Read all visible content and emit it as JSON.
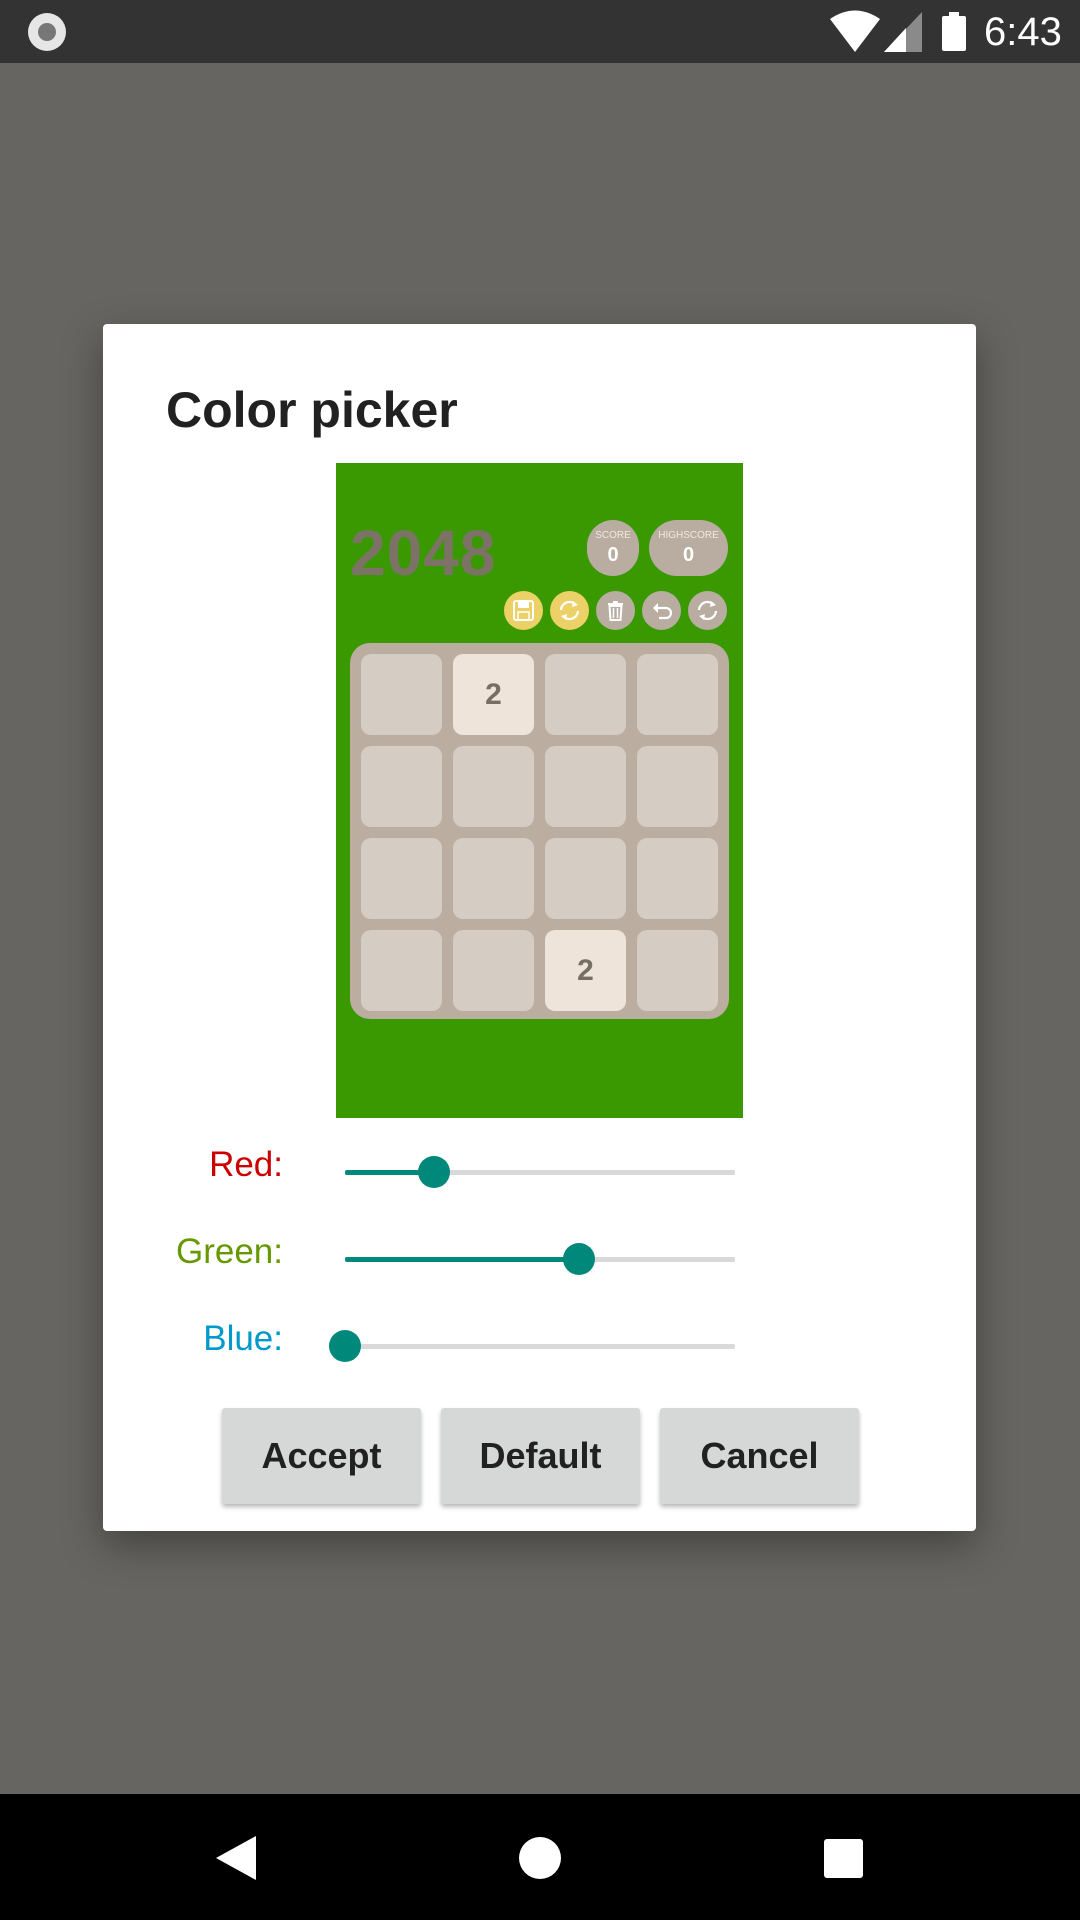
{
  "status_bar": {
    "time": "6:43",
    "icons": [
      "record-icon",
      "wifi-icon",
      "signal-icon",
      "battery-icon"
    ]
  },
  "dialog": {
    "title": "Color picker",
    "preview": {
      "background_color": "#3a9900",
      "game_title": "2048",
      "score_label": "SCORE",
      "score_value": "0",
      "highscore_label": "HIGHSCORE",
      "highscore_value": "0",
      "toolbar_icons": [
        "save-icon",
        "sync-icon",
        "trash-icon",
        "undo-icon",
        "restart-icon"
      ],
      "grid": [
        [
          "",
          "2",
          "",
          ""
        ],
        [
          "",
          "",
          "",
          ""
        ],
        [
          "",
          "",
          "",
          ""
        ],
        [
          "",
          "",
          "2",
          ""
        ]
      ]
    },
    "sliders": [
      {
        "label": "Red:",
        "color": "#cc0000",
        "value": 58
      },
      {
        "label": "Green:",
        "color": "#669900",
        "value": 153
      },
      {
        "label": "Blue:",
        "color": "#0099cc",
        "value": 0
      }
    ],
    "buttons": {
      "accept": "Accept",
      "default": "Default",
      "cancel": "Cancel"
    }
  },
  "nav_bar": {
    "icons": [
      "back-icon",
      "home-icon",
      "recents-icon"
    ]
  }
}
